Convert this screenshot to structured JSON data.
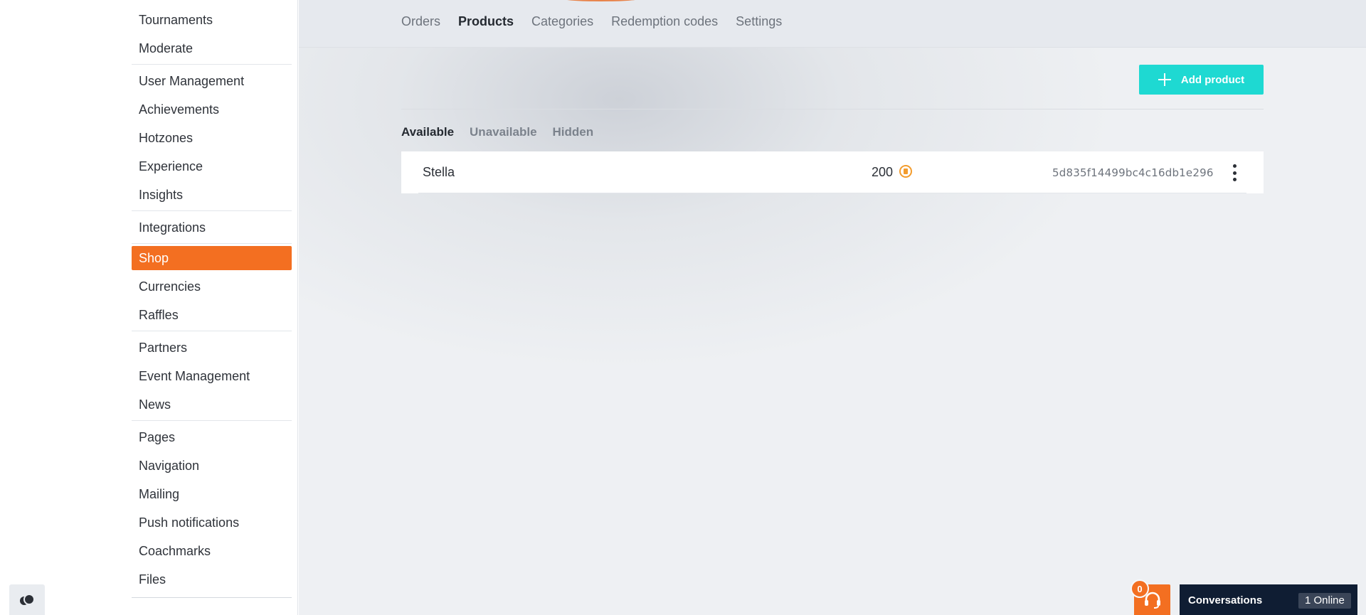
{
  "sidebar": {
    "groups": [
      [
        "Tournaments",
        "Moderate"
      ],
      [
        "User Management",
        "Achievements",
        "Hotzones",
        "Experience",
        "Insights"
      ],
      [
        "Integrations"
      ],
      [
        "Shop",
        "Currencies",
        "Raffles"
      ],
      [
        "Partners",
        "Event Management",
        "News"
      ],
      [
        "Pages",
        "Navigation",
        "Mailing",
        "Push notifications",
        "Coachmarks",
        "Files"
      ]
    ],
    "active_item": "Shop"
  },
  "top_tabs": {
    "items": [
      "Orders",
      "Products",
      "Categories",
      "Redemption codes",
      "Settings"
    ],
    "active": "Products"
  },
  "toolbar": {
    "add_product_label": "Add product"
  },
  "sub_tabs": {
    "items": [
      "Available",
      "Unavailable",
      "Hidden"
    ],
    "active": "Available"
  },
  "products": [
    {
      "name": "Stella",
      "price": "200",
      "id": "5d835f14499bc4c16db1e296"
    }
  ],
  "support": {
    "badge_count": "0"
  },
  "conversations": {
    "label": "Conversations",
    "online": "1 Online"
  },
  "colors": {
    "accent": "#f36f21",
    "primary_button": "#1ed9d2",
    "coin": "#f39c2d",
    "conversation_bar": "#0f1d33"
  },
  "icons": [
    "plus-icon",
    "coin-icon",
    "more-vertical-icon",
    "headset-icon",
    "theme-toggle-icon"
  ]
}
